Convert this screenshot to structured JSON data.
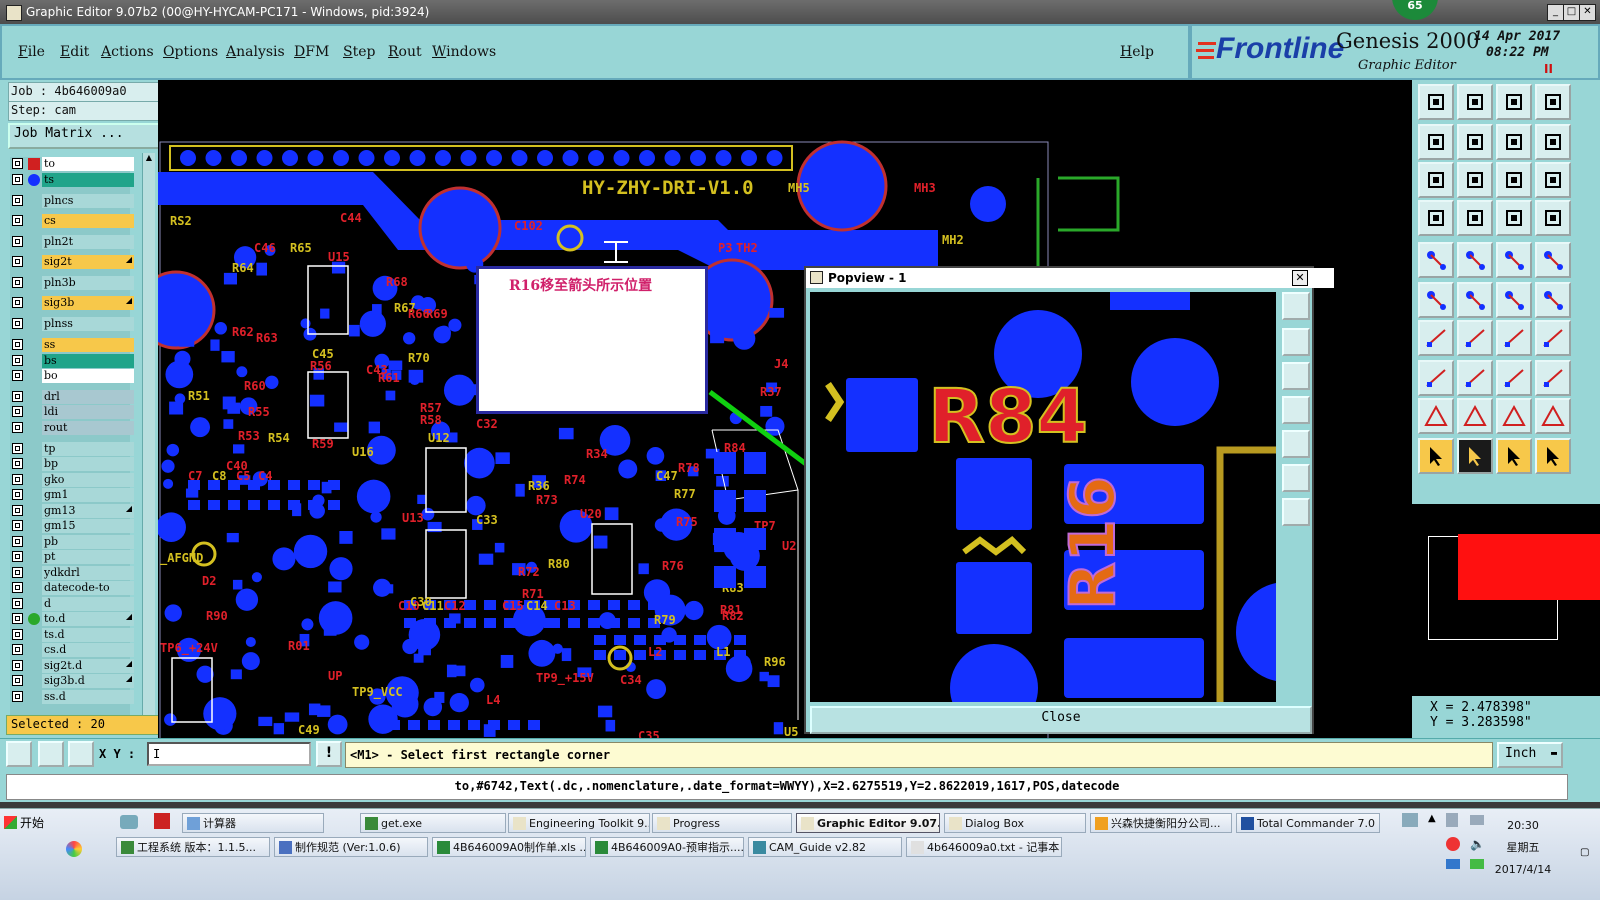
{
  "window": {
    "title": "Graphic Editor 9.07b2 (00@HY-HYCAM-PC171 - Windows, pid:3924)",
    "badge": "65"
  },
  "menu": [
    "File",
    "Edit",
    "Actions",
    "Options",
    "Analysis",
    "DFM",
    "Step",
    "Rout",
    "Windows"
  ],
  "help_label": "Help",
  "brand": {
    "logo": "Frontline",
    "product": "Genesis 2000",
    "subtitle": "Graphic Editor",
    "date": "14 Apr 2017",
    "time": "08:22 PM",
    "pause": "II"
  },
  "job": {
    "job_line": "Job : 4b646009a0",
    "step_line": "Step: cam",
    "matrix_button": "Job Matrix ..."
  },
  "layers": [
    {
      "name": "to",
      "color": "#ffffff"
    },
    {
      "name": "ts",
      "color": "#20a48a"
    },
    {
      "name": "plncs",
      "color": "#a8d8d8"
    },
    {
      "name": "cs",
      "color": "#f7c84a"
    },
    {
      "name": "pln2t",
      "color": "#a8d8d8"
    },
    {
      "name": "sig2t",
      "color": "#f7c84a"
    },
    {
      "name": "pln3b",
      "color": "#a8d8d8"
    },
    {
      "name": "sig3b",
      "color": "#f7c84a"
    },
    {
      "name": "plnss",
      "color": "#a8d8d8"
    },
    {
      "name": "ss",
      "color": "#f7c84a"
    },
    {
      "name": "bs",
      "color": "#20a48a"
    },
    {
      "name": "bo",
      "color": "#ffffff"
    },
    {
      "name": "drl",
      "color": "#a8c8d0"
    },
    {
      "name": "ldi",
      "color": "#a8c8d0"
    },
    {
      "name": "rout",
      "color": "#a8c8d0"
    },
    {
      "name": "tp",
      "color": "#a8d8d8"
    },
    {
      "name": "bp",
      "color": "#a8d8d8"
    },
    {
      "name": "gko",
      "color": "#a8d8d8"
    },
    {
      "name": "gm1",
      "color": "#a8d8d8"
    },
    {
      "name": "gm13",
      "color": "#a8d8d8"
    },
    {
      "name": "gm15",
      "color": "#a8d8d8"
    },
    {
      "name": "pb",
      "color": "#a8d8d8"
    },
    {
      "name": "pt",
      "color": "#a8d8d8"
    },
    {
      "name": "ydkdrl",
      "color": "#a8d8d8"
    },
    {
      "name": "datecode-to",
      "color": "#a8d8d8"
    },
    {
      "name": "d",
      "color": "#a8d8d8"
    },
    {
      "name": "to.d",
      "color": "#a8d8d8"
    },
    {
      "name": "ts.d",
      "color": "#a8d8d8"
    },
    {
      "name": "cs.d",
      "color": "#a8d8d8"
    },
    {
      "name": "sig2t.d",
      "color": "#a8d8d8"
    },
    {
      "name": "sig3b.d",
      "color": "#a8d8d8"
    },
    {
      "name": "ss.d",
      "color": "#a8d8d8"
    }
  ],
  "selected_count": "Selected : 20",
  "board": {
    "title_silk": "HY-ZHY-DRI-V1.0",
    "labels": [
      "RS2",
      "C44",
      "C46",
      "R65",
      "U15",
      "R68",
      "R67",
      "R66",
      "R69",
      "R64",
      "R62",
      "R63",
      "C45",
      "R56",
      "C43",
      "R70",
      "R61",
      "R60",
      "R51",
      "R55",
      "R53",
      "R54",
      "C40",
      "R59",
      "U16",
      "R57",
      "R58",
      "U12",
      "C32",
      "C7",
      "C8",
      "C5",
      "C4",
      "R36",
      "R74",
      "R34",
      "C47",
      "R78",
      "R73",
      "R77",
      "R75",
      "U13",
      "C33",
      "U20",
      "R72",
      "R80",
      "R71",
      "C10",
      "C11",
      "C12",
      "C15",
      "C14",
      "C13",
      "R76",
      "R79",
      "R82",
      "R81",
      "R83",
      "R84",
      "R37",
      "R96",
      "R90",
      "R01",
      "C30",
      "L4",
      "L2",
      "L1",
      "C34",
      "C35",
      "U5",
      "U2",
      "TP7",
      "C49",
      "C102",
      "MH3",
      "MH5",
      "P3",
      "TH2",
      "MH2",
      "J4",
      "D2",
      "TP9_VCC",
      "TP9_+15V",
      "TP6_+24V",
      "_AFGND",
      "UP"
    ]
  },
  "note_text": "R16移至箭头所示位置",
  "popview": {
    "title": "Popview - 1",
    "ref_r84": "R84",
    "ref_r16": "R16",
    "close_label": "Close"
  },
  "coords": {
    "x": "X = 2.478398\"",
    "y": "Y = 3.283598\""
  },
  "command": {
    "xy_label": "X Y :",
    "xy_value": "I",
    "message": "<M1> - Select first rectangle corner",
    "unit": "Inch"
  },
  "status_text": "to,#6742,Text(.dc,.nomenclature,.date_format=WWYY),X=2.6275519,Y=2.8622019,1617,POS,datecode",
  "taskbar": {
    "start": "开始",
    "row1": [
      "计算器",
      "get.exe",
      "Engineering Toolkit 9....",
      "Progress",
      "Graphic Editor 9.07...",
      "Dialog Box",
      "兴森快捷衡阳分公司...",
      "Total Commander 7.0 ..."
    ],
    "row2": [
      "工程系统  版本：1.1.5...",
      "制作规范 (Ver:1.0.6)",
      "4B646009A0制作单.xls ...",
      "4B646009A0-预审指示....",
      "CAM_Guide v2.82",
      "4b646009a0.txt - 记事本"
    ],
    "clock_time": "20:30",
    "clock_day": "星期五",
    "clock_date": "2017/4/14"
  },
  "colors": {
    "panel": "#98d6d6",
    "copper": "#1430ff",
    "silk_red": "#e0202a",
    "silk_yellow": "#d4c020",
    "arrow": "#10d010"
  }
}
